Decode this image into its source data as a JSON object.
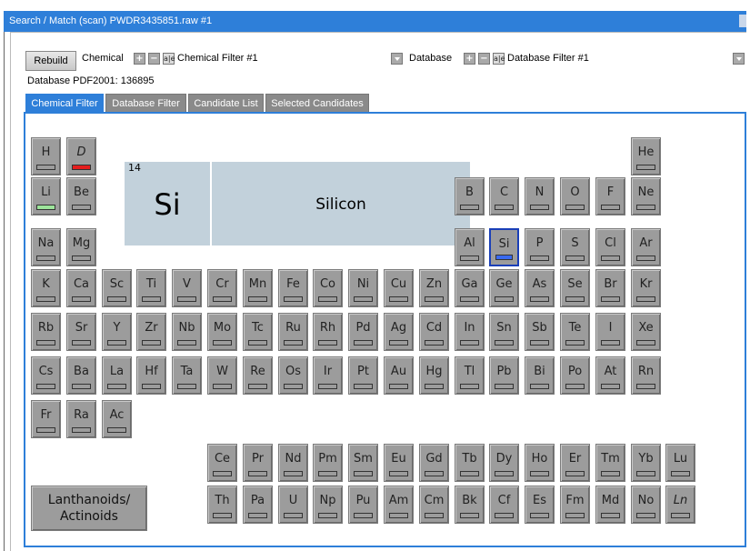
{
  "window": {
    "title": "Search / Match (scan) PWDR3435851.raw #1"
  },
  "toolbar": {
    "rebuild_label": "Rebuild",
    "chemical_label": "Chemical",
    "chemical_filter_value": "Chemical Filter #1",
    "database_label": "Database",
    "database_filter_value": "Database Filter #1",
    "plus_glyph": "+",
    "minus_glyph": "−",
    "ae_glyph": "a|e"
  },
  "database_info": "Database PDF2001: 136895",
  "tabs": [
    "Chemical Filter",
    "Database Filter",
    "Candidate List",
    "Selected Candidates"
  ],
  "active_tab": "Chemical Filter",
  "selected_element": {
    "number": "14",
    "symbol": "Si",
    "name": "Silicon"
  },
  "lanthanoids_button": {
    "line1": "Lanthanoids/",
    "line2": "Actinoids"
  },
  "colors": {
    "accent": "#2e7fd9",
    "cell": "#9c9c9c",
    "selected_bar": "#3a6af0",
    "excluded_bar": "#e51d1d",
    "included_bar": "#9de49b",
    "panel": "#c2d1db"
  },
  "periodic_table": [
    {
      "sym": "H",
      "r": 0,
      "c": 0
    },
    {
      "sym": "D",
      "r": 0,
      "c": 1,
      "state": "red",
      "italic": true
    },
    {
      "sym": "He",
      "r": 0,
      "c": 17
    },
    {
      "sym": "Li",
      "r": 1,
      "c": 0,
      "state": "green"
    },
    {
      "sym": "Be",
      "r": 1,
      "c": 1
    },
    {
      "sym": "B",
      "r": 1,
      "c": 12
    },
    {
      "sym": "C",
      "r": 1,
      "c": 13
    },
    {
      "sym": "N",
      "r": 1,
      "c": 14
    },
    {
      "sym": "O",
      "r": 1,
      "c": 15
    },
    {
      "sym": "F",
      "r": 1,
      "c": 16
    },
    {
      "sym": "Ne",
      "r": 1,
      "c": 17
    },
    {
      "sym": "Na",
      "r": 2,
      "c": 0
    },
    {
      "sym": "Mg",
      "r": 2,
      "c": 1
    },
    {
      "sym": "Al",
      "r": 2,
      "c": 12
    },
    {
      "sym": "Si",
      "r": 2,
      "c": 13,
      "state": "selected"
    },
    {
      "sym": "P",
      "r": 2,
      "c": 14
    },
    {
      "sym": "S",
      "r": 2,
      "c": 15
    },
    {
      "sym": "Cl",
      "r": 2,
      "c": 16
    },
    {
      "sym": "Ar",
      "r": 2,
      "c": 17
    },
    {
      "sym": "K",
      "r": 3,
      "c": 0
    },
    {
      "sym": "Ca",
      "r": 3,
      "c": 1
    },
    {
      "sym": "Sc",
      "r": 3,
      "c": 2
    },
    {
      "sym": "Ti",
      "r": 3,
      "c": 3
    },
    {
      "sym": "V",
      "r": 3,
      "c": 4
    },
    {
      "sym": "Cr",
      "r": 3,
      "c": 5
    },
    {
      "sym": "Mn",
      "r": 3,
      "c": 6
    },
    {
      "sym": "Fe",
      "r": 3,
      "c": 7
    },
    {
      "sym": "Co",
      "r": 3,
      "c": 8
    },
    {
      "sym": "Ni",
      "r": 3,
      "c": 9
    },
    {
      "sym": "Cu",
      "r": 3,
      "c": 10
    },
    {
      "sym": "Zn",
      "r": 3,
      "c": 11
    },
    {
      "sym": "Ga",
      "r": 3,
      "c": 12
    },
    {
      "sym": "Ge",
      "r": 3,
      "c": 13
    },
    {
      "sym": "As",
      "r": 3,
      "c": 14
    },
    {
      "sym": "Se",
      "r": 3,
      "c": 15
    },
    {
      "sym": "Br",
      "r": 3,
      "c": 16
    },
    {
      "sym": "Kr",
      "r": 3,
      "c": 17
    },
    {
      "sym": "Rb",
      "r": 4,
      "c": 0
    },
    {
      "sym": "Sr",
      "r": 4,
      "c": 1
    },
    {
      "sym": "Y",
      "r": 4,
      "c": 2
    },
    {
      "sym": "Zr",
      "r": 4,
      "c": 3
    },
    {
      "sym": "Nb",
      "r": 4,
      "c": 4
    },
    {
      "sym": "Mo",
      "r": 4,
      "c": 5
    },
    {
      "sym": "Tc",
      "r": 4,
      "c": 6
    },
    {
      "sym": "Ru",
      "r": 4,
      "c": 7
    },
    {
      "sym": "Rh",
      "r": 4,
      "c": 8
    },
    {
      "sym": "Pd",
      "r": 4,
      "c": 9
    },
    {
      "sym": "Ag",
      "r": 4,
      "c": 10
    },
    {
      "sym": "Cd",
      "r": 4,
      "c": 11
    },
    {
      "sym": "In",
      "r": 4,
      "c": 12
    },
    {
      "sym": "Sn",
      "r": 4,
      "c": 13
    },
    {
      "sym": "Sb",
      "r": 4,
      "c": 14
    },
    {
      "sym": "Te",
      "r": 4,
      "c": 15
    },
    {
      "sym": "I",
      "r": 4,
      "c": 16
    },
    {
      "sym": "Xe",
      "r": 4,
      "c": 17
    },
    {
      "sym": "Cs",
      "r": 5,
      "c": 0
    },
    {
      "sym": "Ba",
      "r": 5,
      "c": 1
    },
    {
      "sym": "La",
      "r": 5,
      "c": 2
    },
    {
      "sym": "Hf",
      "r": 5,
      "c": 3
    },
    {
      "sym": "Ta",
      "r": 5,
      "c": 4
    },
    {
      "sym": "W",
      "r": 5,
      "c": 5
    },
    {
      "sym": "Re",
      "r": 5,
      "c": 6
    },
    {
      "sym": "Os",
      "r": 5,
      "c": 7
    },
    {
      "sym": "Ir",
      "r": 5,
      "c": 8
    },
    {
      "sym": "Pt",
      "r": 5,
      "c": 9
    },
    {
      "sym": "Au",
      "r": 5,
      "c": 10
    },
    {
      "sym": "Hg",
      "r": 5,
      "c": 11
    },
    {
      "sym": "Tl",
      "r": 5,
      "c": 12
    },
    {
      "sym": "Pb",
      "r": 5,
      "c": 13
    },
    {
      "sym": "Bi",
      "r": 5,
      "c": 14
    },
    {
      "sym": "Po",
      "r": 5,
      "c": 15
    },
    {
      "sym": "At",
      "r": 5,
      "c": 16
    },
    {
      "sym": "Rn",
      "r": 5,
      "c": 17
    },
    {
      "sym": "Fr",
      "r": 6,
      "c": 0
    },
    {
      "sym": "Ra",
      "r": 6,
      "c": 1
    },
    {
      "sym": "Ac",
      "r": 6,
      "c": 2
    },
    {
      "sym": "Ce",
      "r": 7,
      "c": 5
    },
    {
      "sym": "Pr",
      "r": 7,
      "c": 6
    },
    {
      "sym": "Nd",
      "r": 7,
      "c": 7
    },
    {
      "sym": "Pm",
      "r": 7,
      "c": 8
    },
    {
      "sym": "Sm",
      "r": 7,
      "c": 9
    },
    {
      "sym": "Eu",
      "r": 7,
      "c": 10
    },
    {
      "sym": "Gd",
      "r": 7,
      "c": 11
    },
    {
      "sym": "Tb",
      "r": 7,
      "c": 12
    },
    {
      "sym": "Dy",
      "r": 7,
      "c": 13
    },
    {
      "sym": "Ho",
      "r": 7,
      "c": 14
    },
    {
      "sym": "Er",
      "r": 7,
      "c": 15
    },
    {
      "sym": "Tm",
      "r": 7,
      "c": 16
    },
    {
      "sym": "Yb",
      "r": 7,
      "c": 17
    },
    {
      "sym": "Lu",
      "r": 7,
      "c": 18
    },
    {
      "sym": "Th",
      "r": 8,
      "c": 5
    },
    {
      "sym": "Pa",
      "r": 8,
      "c": 6
    },
    {
      "sym": "U",
      "r": 8,
      "c": 7
    },
    {
      "sym": "Np",
      "r": 8,
      "c": 8
    },
    {
      "sym": "Pu",
      "r": 8,
      "c": 9
    },
    {
      "sym": "Am",
      "r": 8,
      "c": 10
    },
    {
      "sym": "Cm",
      "r": 8,
      "c": 11
    },
    {
      "sym": "Bk",
      "r": 8,
      "c": 12
    },
    {
      "sym": "Cf",
      "r": 8,
      "c": 13
    },
    {
      "sym": "Es",
      "r": 8,
      "c": 14
    },
    {
      "sym": "Fm",
      "r": 8,
      "c": 15
    },
    {
      "sym": "Md",
      "r": 8,
      "c": 16
    },
    {
      "sym": "No",
      "r": 8,
      "c": 17
    },
    {
      "sym": "Ln",
      "r": 8,
      "c": 18,
      "italic": true
    }
  ]
}
